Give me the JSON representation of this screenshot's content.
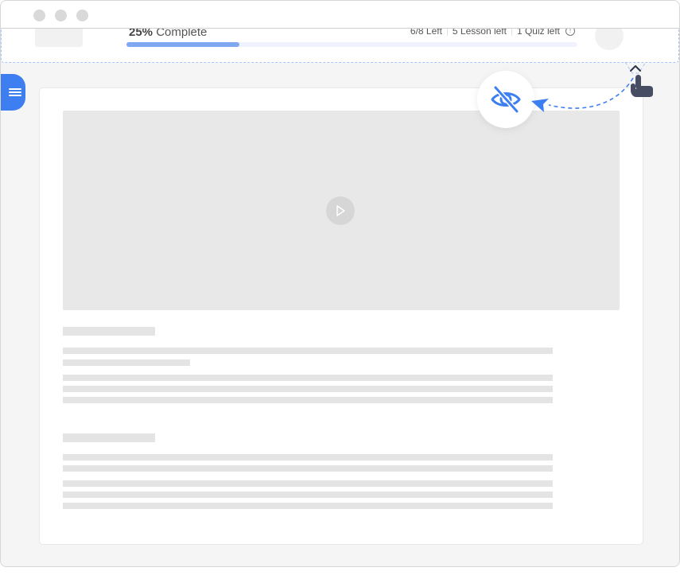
{
  "window": {
    "traffic_lights": [
      "window-dot",
      "window-dot",
      "window-dot"
    ]
  },
  "header": {
    "progress_percent_label": "25%",
    "progress_suffix": "Complete",
    "progress_fraction": 0.25,
    "stats": [
      {
        "label": "6/8 Left"
      },
      {
        "label": "5 Lesson left"
      },
      {
        "label": "1 Quiz left"
      }
    ],
    "info_icon": "info-icon",
    "info_glyph": "!"
  },
  "sidebar_toggle": {
    "icon": "menu-icon"
  },
  "focus_mode": {
    "icon": "eye-off-icon",
    "collapse_icon": "chevron-up-icon",
    "pointer_icon": "hand-pointer-icon"
  },
  "content": {
    "video": {
      "icon": "play-icon"
    }
  },
  "colors": {
    "accent": "#3d7ff0",
    "progress_fill": "#7fa7f2",
    "skeleton": "#e4e4e4"
  }
}
